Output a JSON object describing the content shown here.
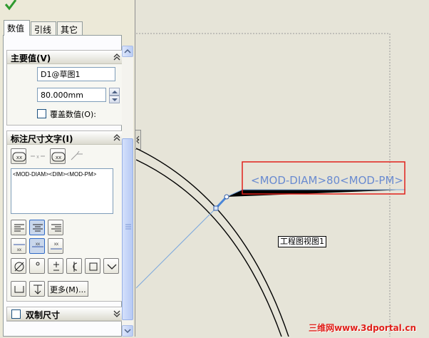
{
  "tabs": [
    "数值",
    "引线",
    "其它"
  ],
  "primary_group": {
    "title": "主要值(V)",
    "name_field": "D1@草图1",
    "value_field": "80.000mm",
    "override_label": "覆盖数值(O):"
  },
  "dim_text_group": {
    "title": "标注尺寸文字(I)",
    "text_value": "<MOD-DIAM><DIM><MOD-PM>",
    "more_button": "更多(M)..."
  },
  "dual_group": {
    "title": "双制尺寸"
  },
  "drawing": {
    "dimension_text": "<MOD-DIAM>80<MOD-PM>",
    "view_label": "工程图视图1"
  },
  "watermark": "三维网www.3dportal.cn",
  "colors": {
    "dimension_blue": "#6a8bd0",
    "highlight_red": "#e0201a"
  }
}
